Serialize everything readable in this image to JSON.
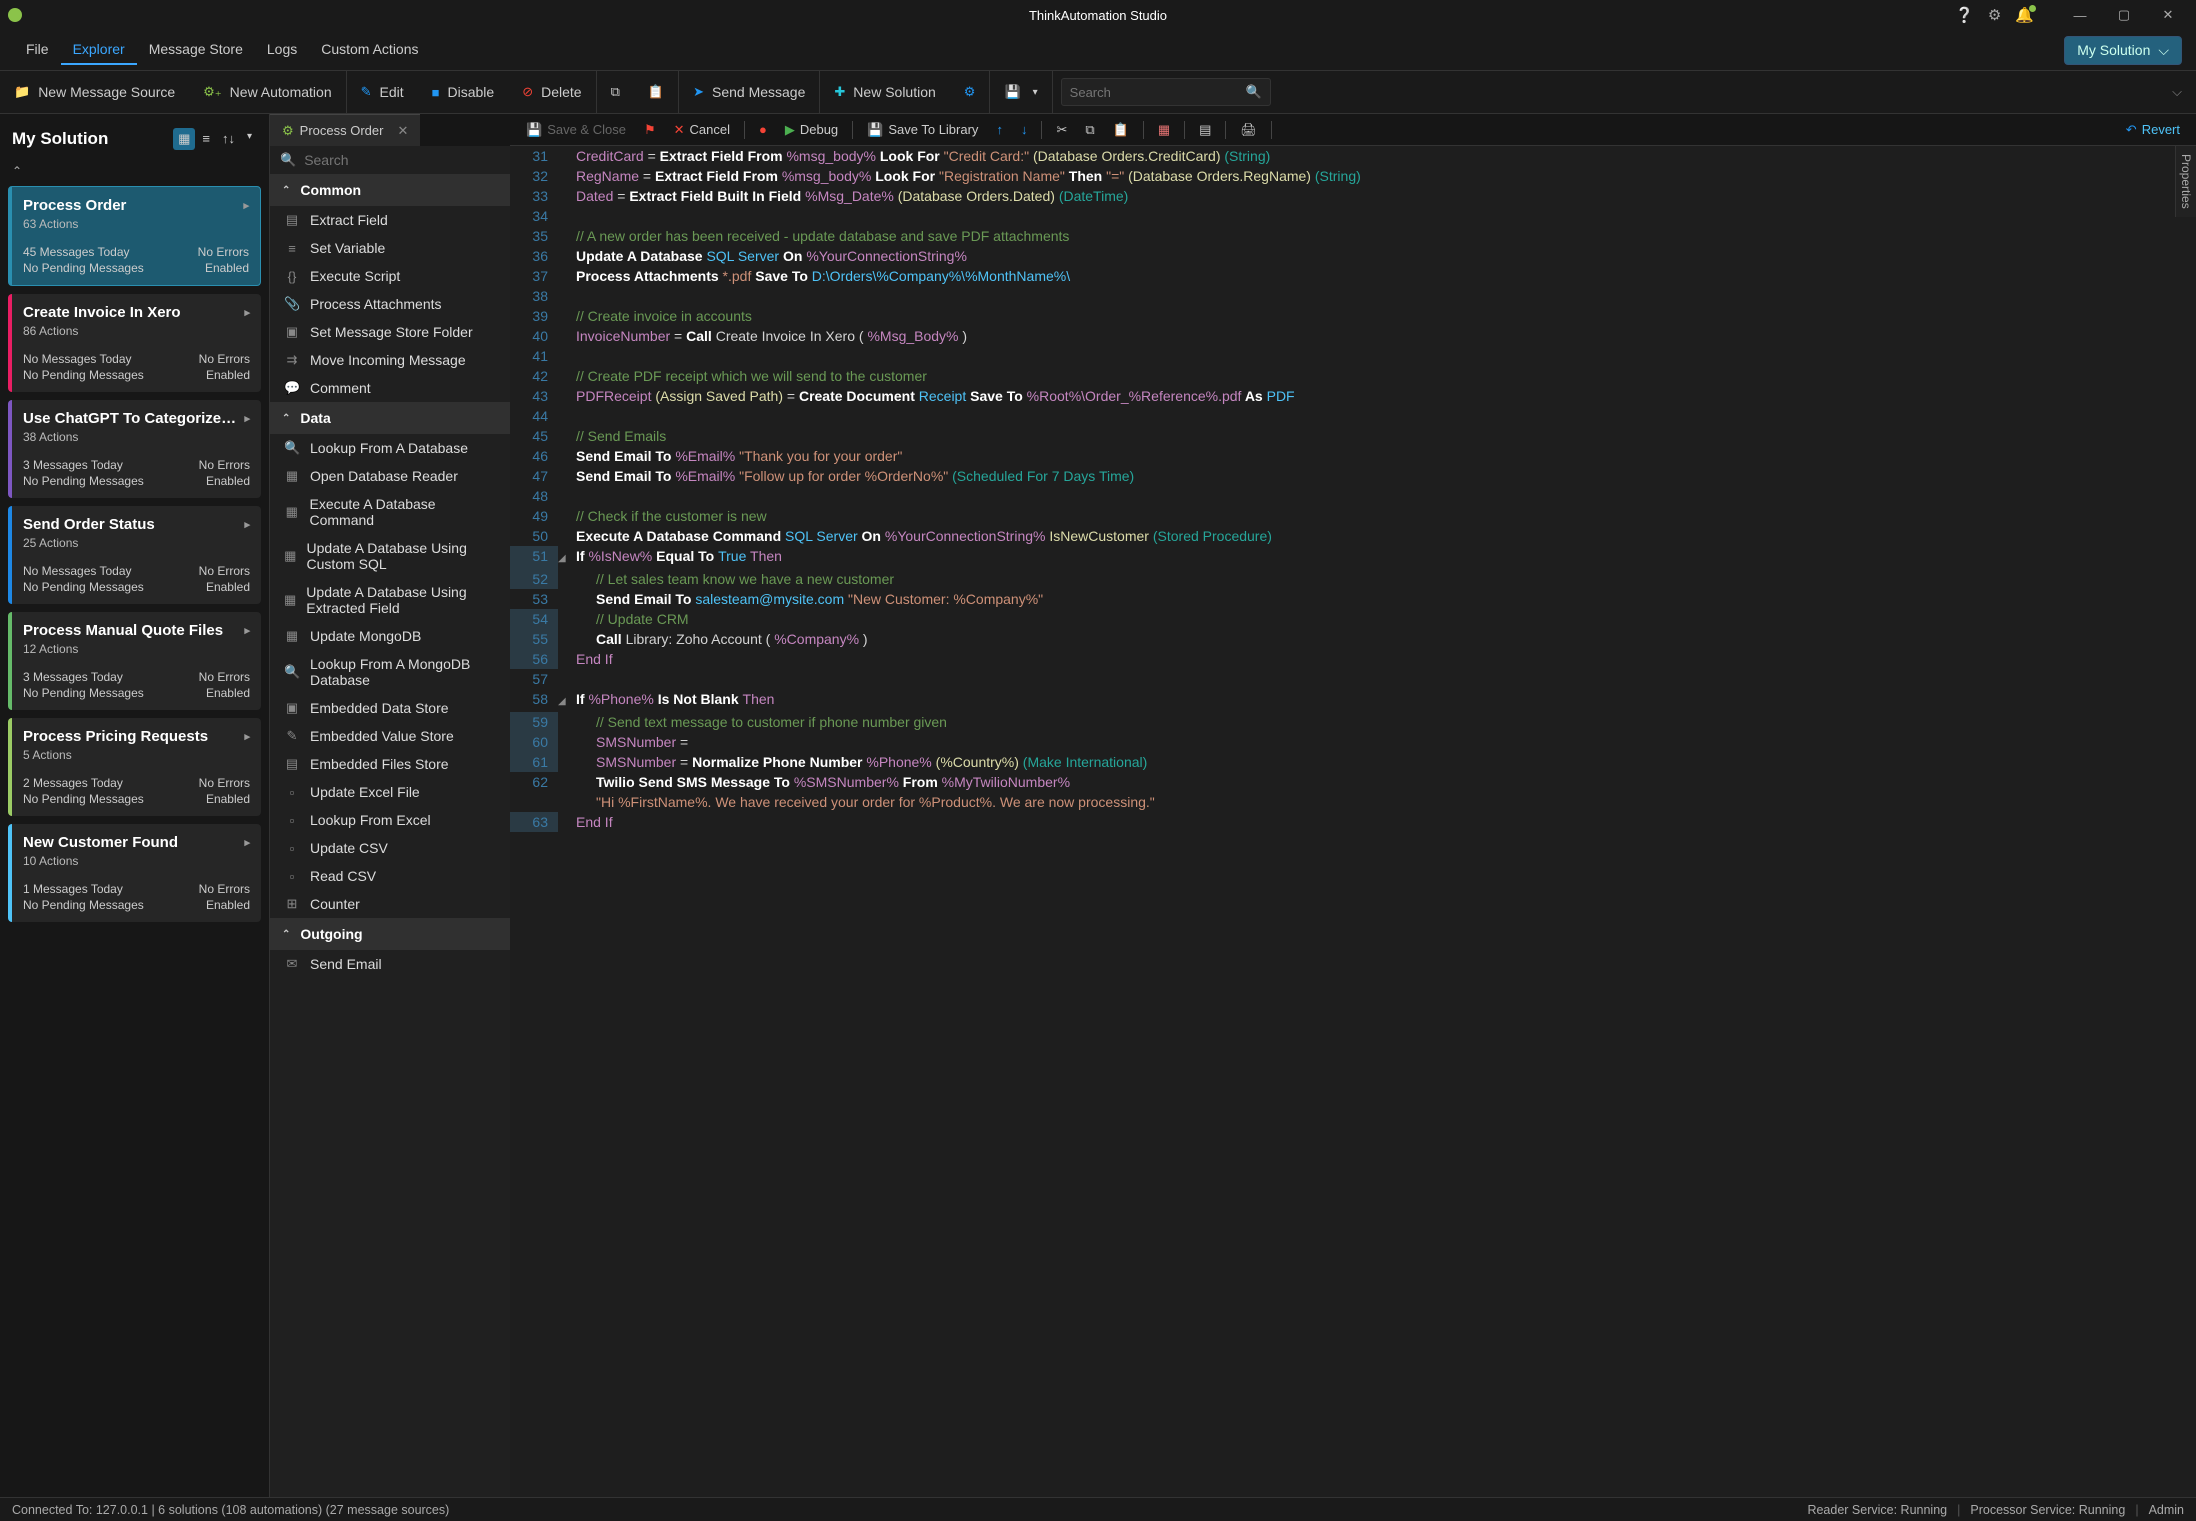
{
  "app_title": "ThinkAutomation Studio",
  "menubar": {
    "items": [
      "File",
      "Explorer",
      "Message Store",
      "Logs",
      "Custom Actions"
    ],
    "active": 1,
    "right_pill": "My Solution"
  },
  "toolbar": {
    "new_msg_src": "New Message Source",
    "new_automation": "New Automation",
    "edit": "Edit",
    "disable": "Disable",
    "delete": "Delete",
    "send_msg": "Send Message",
    "new_solution": "New Solution",
    "search_placeholder": "Search"
  },
  "sidebar": {
    "title": "My Solution",
    "cards": [
      {
        "title": "Process Order",
        "actions": "63 Actions",
        "m": "45 Messages Today",
        "e": "No Errors",
        "p": "No Pending Messages",
        "s": "Enabled",
        "color": "b-teal",
        "sel": true
      },
      {
        "title": "Create Invoice In Xero",
        "actions": "86 Actions",
        "m": "No Messages Today",
        "e": "No Errors",
        "p": "No Pending Messages",
        "s": "Enabled",
        "color": "b-pink"
      },
      {
        "title": "Use ChatGPT To Categorize…",
        "actions": "38 Actions",
        "m": "3 Messages Today",
        "e": "No Errors",
        "p": "No Pending Messages",
        "s": "Enabled",
        "color": "b-purple"
      },
      {
        "title": "Send Order Status",
        "actions": "25 Actions",
        "m": "No Messages Today",
        "e": "No Errors",
        "p": "No Pending Messages",
        "s": "Enabled",
        "color": "b-blue"
      },
      {
        "title": "Process Manual Quote Files",
        "actions": "12 Actions",
        "m": "3 Messages Today",
        "e": "No Errors",
        "p": "No Pending Messages",
        "s": "Enabled",
        "color": "b-green"
      },
      {
        "title": "Process Pricing Requests",
        "actions": "5 Actions",
        "m": "2 Messages Today",
        "e": "No Errors",
        "p": "No Pending Messages",
        "s": "Enabled",
        "color": "b-lime"
      },
      {
        "title": "New Customer Found",
        "actions": "10 Actions",
        "m": "1 Messages Today",
        "e": "No Errors",
        "p": "No Pending Messages",
        "s": "Enabled",
        "color": "b-sky"
      }
    ]
  },
  "center": {
    "tab": "Process Order",
    "search_placeholder": "Search",
    "groups": [
      {
        "name": "Common",
        "items": [
          {
            "i": "▤",
            "l": "Extract Field"
          },
          {
            "i": "≡",
            "l": "Set Variable"
          },
          {
            "i": "{}",
            "l": "Execute Script"
          },
          {
            "i": "📎",
            "l": "Process Attachments"
          },
          {
            "i": "▣",
            "l": "Set Message Store Folder"
          },
          {
            "i": "⇉",
            "l": "Move Incoming Message"
          },
          {
            "i": "💬",
            "l": "Comment"
          }
        ]
      },
      {
        "name": "Data",
        "items": [
          {
            "i": "🔍",
            "l": "Lookup From A Database"
          },
          {
            "i": "▦",
            "l": "Open Database Reader"
          },
          {
            "i": "▦",
            "l": "Execute A Database Command"
          },
          {
            "i": "▦",
            "l": "Update A Database Using Custom SQL"
          },
          {
            "i": "▦",
            "l": "Update A Database Using Extracted Field"
          },
          {
            "i": "▦",
            "l": "Update MongoDB"
          },
          {
            "i": "🔍",
            "l": "Lookup From A MongoDB Database"
          },
          {
            "i": "▣",
            "l": "Embedded Data Store"
          },
          {
            "i": "✎",
            "l": "Embedded Value Store"
          },
          {
            "i": "▤",
            "l": "Embedded Files Store"
          },
          {
            "i": "▫",
            "l": "Update Excel File"
          },
          {
            "i": "▫",
            "l": "Lookup From Excel"
          },
          {
            "i": "▫",
            "l": "Update CSV"
          },
          {
            "i": "▫",
            "l": "Read CSV"
          },
          {
            "i": "⊞",
            "l": "Counter"
          }
        ]
      },
      {
        "name": "Outgoing",
        "items": [
          {
            "i": "✉",
            "l": "Send Email"
          }
        ]
      }
    ]
  },
  "editor_toolbar": {
    "save_close": "Save & Close",
    "cancel": "Cancel",
    "debug": "Debug",
    "save_lib": "Save To Library",
    "revert": "Revert"
  },
  "code": [
    {
      "n": 31,
      "t": [
        [
          "c-var",
          "CreditCard"
        ],
        [
          "c-w",
          " = "
        ],
        [
          "c-key",
          "Extract Field From "
        ],
        [
          "c-pur",
          "%msg_body%"
        ],
        [
          "c-key",
          " Look For "
        ],
        [
          "c-orange",
          "\"Credit Card:\""
        ],
        [
          "c-w",
          " "
        ],
        [
          "c-ylw",
          "(Database Orders.CreditCard)"
        ],
        [
          "c-w",
          " "
        ],
        [
          "c-teal",
          "(String)"
        ]
      ]
    },
    {
      "n": 32,
      "t": [
        [
          "c-var",
          "RegName"
        ],
        [
          "c-w",
          " = "
        ],
        [
          "c-key",
          "Extract Field From "
        ],
        [
          "c-pur",
          "%msg_body%"
        ],
        [
          "c-key",
          " Look For "
        ],
        [
          "c-orange",
          "\"Registration Name\""
        ],
        [
          "c-key",
          " Then "
        ],
        [
          "c-orange",
          "\"=\""
        ],
        [
          "c-w",
          " "
        ],
        [
          "c-ylw",
          "(Database Orders.RegName)"
        ],
        [
          "c-w",
          " "
        ],
        [
          "c-teal",
          "(String)"
        ]
      ]
    },
    {
      "n": 33,
      "t": [
        [
          "c-var",
          "Dated"
        ],
        [
          "c-w",
          " = "
        ],
        [
          "c-key",
          "Extract Field Built In Field "
        ],
        [
          "c-pur",
          "%Msg_Date%"
        ],
        [
          "c-w",
          " "
        ],
        [
          "c-ylw",
          "(Database Orders.Dated)"
        ],
        [
          "c-w",
          " "
        ],
        [
          "c-teal",
          "(DateTime)"
        ]
      ]
    },
    {
      "n": 34,
      "t": []
    },
    {
      "n": 35,
      "t": [
        [
          "c-green",
          "// A new order has been received - update database and save PDF attachments"
        ]
      ]
    },
    {
      "n": 36,
      "t": [
        [
          "c-key",
          "Update A Database "
        ],
        [
          "c-blue",
          "SQL Server"
        ],
        [
          "c-key",
          " On "
        ],
        [
          "c-pur",
          "%YourConnectionString%"
        ]
      ]
    },
    {
      "n": 37,
      "t": [
        [
          "c-key",
          "Process Attachments "
        ],
        [
          "c-orange",
          "*.pdf"
        ],
        [
          "c-key",
          " Save To "
        ],
        [
          "c-blue",
          "D:\\Orders\\%Company%\\%MonthName%\\"
        ]
      ]
    },
    {
      "n": 38,
      "t": []
    },
    {
      "n": 39,
      "t": [
        [
          "c-green",
          "// Create invoice in accounts"
        ]
      ]
    },
    {
      "n": 40,
      "t": [
        [
          "c-var",
          "InvoiceNumber"
        ],
        [
          "c-w",
          " = "
        ],
        [
          "c-key",
          "Call "
        ],
        [
          "c-w",
          "Create Invoice In Xero ( "
        ],
        [
          "c-pur",
          "%Msg_Body%"
        ],
        [
          "c-w",
          " )"
        ]
      ]
    },
    {
      "n": 41,
      "t": []
    },
    {
      "n": 42,
      "t": [
        [
          "c-green",
          "// Create PDF receipt which we will send to the customer"
        ]
      ]
    },
    {
      "n": 43,
      "t": [
        [
          "c-var",
          "PDFReceipt"
        ],
        [
          "c-w",
          " "
        ],
        [
          "c-ylw",
          "(Assign Saved Path)"
        ],
        [
          "c-w",
          " = "
        ],
        [
          "c-key",
          "Create Document "
        ],
        [
          "c-blue",
          "Receipt"
        ],
        [
          "c-key",
          " Save To "
        ],
        [
          "c-pur",
          "%Root%\\Order_%Reference%.pdf"
        ],
        [
          "c-key",
          " As "
        ],
        [
          "c-blue",
          "PDF"
        ]
      ]
    },
    {
      "n": 44,
      "t": []
    },
    {
      "n": 45,
      "t": [
        [
          "c-green",
          "// Send Emails"
        ]
      ]
    },
    {
      "n": 46,
      "t": [
        [
          "c-key",
          "Send Email To "
        ],
        [
          "c-pur",
          "%Email%"
        ],
        [
          "c-w",
          " "
        ],
        [
          "c-orange",
          "\"Thank you for your order\""
        ]
      ]
    },
    {
      "n": 47,
      "t": [
        [
          "c-key",
          "Send Email To "
        ],
        [
          "c-pur",
          "%Email%"
        ],
        [
          "c-w",
          " "
        ],
        [
          "c-orange",
          "\"Follow up for order %OrderNo%\""
        ],
        [
          "c-w",
          " "
        ],
        [
          "c-teal",
          "(Scheduled For 7 Days Time)"
        ]
      ]
    },
    {
      "n": 48,
      "t": []
    },
    {
      "n": 49,
      "t": [
        [
          "c-green",
          "// Check if the customer is new"
        ]
      ]
    },
    {
      "n": 50,
      "t": [
        [
          "c-key",
          "Execute A Database Command "
        ],
        [
          "c-blue",
          "SQL Server"
        ],
        [
          "c-key",
          " On "
        ],
        [
          "c-pur",
          "%YourConnectionString%"
        ],
        [
          "c-w",
          " "
        ],
        [
          "c-ylw",
          "IsNewCustomer"
        ],
        [
          "c-w",
          " "
        ],
        [
          "c-teal",
          "(Stored Procedure)"
        ]
      ]
    },
    {
      "n": 51,
      "fold": true,
      "hi": true,
      "t": [
        [
          "c-key",
          "If "
        ],
        [
          "c-pur",
          "%IsNew%"
        ],
        [
          "c-key",
          " Equal To "
        ],
        [
          "c-blue",
          "True"
        ],
        [
          "c-w",
          " "
        ],
        [
          "c-pur",
          "Then"
        ]
      ]
    },
    {
      "n": 52,
      "ind": 1,
      "hi": true,
      "t": [
        [
          "c-green",
          "// Let sales team know we have a new customer"
        ]
      ]
    },
    {
      "n": 53,
      "ind": 1,
      "t": [
        [
          "c-key",
          "Send Email To "
        ],
        [
          "c-blue",
          "salesteam@mysite.com"
        ],
        [
          "c-w",
          " "
        ],
        [
          "c-orange",
          "\"New Customer: %Company%\""
        ]
      ]
    },
    {
      "n": 54,
      "ind": 1,
      "hi": true,
      "t": [
        [
          "c-green",
          "// Update CRM"
        ]
      ]
    },
    {
      "n": 55,
      "ind": 1,
      "hi": true,
      "t": [
        [
          "c-key",
          "Call "
        ],
        [
          "c-w",
          "Library: Zoho Account ( "
        ],
        [
          "c-pur",
          "%Company%"
        ],
        [
          "c-w",
          " )"
        ]
      ]
    },
    {
      "n": 56,
      "hi": true,
      "t": [
        [
          "c-pur",
          "End If"
        ]
      ]
    },
    {
      "n": 57,
      "t": []
    },
    {
      "n": 58,
      "fold": true,
      "t": [
        [
          "c-key",
          "If "
        ],
        [
          "c-pur",
          "%Phone%"
        ],
        [
          "c-key",
          " Is Not Blank "
        ],
        [
          "c-pur",
          "Then"
        ]
      ]
    },
    {
      "n": 59,
      "ind": 1,
      "hi": true,
      "t": [
        [
          "c-green",
          "// Send text message to customer if phone number given"
        ]
      ]
    },
    {
      "n": 60,
      "ind": 1,
      "hi": true,
      "t": [
        [
          "c-var",
          "SMSNumber"
        ],
        [
          "c-w",
          " ="
        ]
      ]
    },
    {
      "n": 61,
      "ind": 1,
      "hi": true,
      "t": [
        [
          "c-var",
          "SMSNumber"
        ],
        [
          "c-w",
          " = "
        ],
        [
          "c-key",
          "Normalize Phone Number "
        ],
        [
          "c-pur",
          "%Phone%"
        ],
        [
          "c-w",
          " "
        ],
        [
          "c-ylw",
          "(%Country%)"
        ],
        [
          "c-w",
          " "
        ],
        [
          "c-teal",
          "(Make International)"
        ]
      ]
    },
    {
      "n": 62,
      "ind": 1,
      "t": [
        [
          "c-key",
          "Twilio Send SMS Message To "
        ],
        [
          "c-pur",
          "%SMSNumber%"
        ],
        [
          "c-key",
          " From "
        ],
        [
          "c-pur",
          "%MyTwilioNumber%"
        ]
      ],
      "t2": [
        [
          "c-orange",
          "\"Hi %FirstName%. We have received your order for %Product%. We are now processing.\""
        ]
      ]
    },
    {
      "n": 63,
      "hi": true,
      "t": [
        [
          "c-pur",
          "End If"
        ]
      ]
    }
  ],
  "statusbar": {
    "left": "Connected To: 127.0.0.1 | 6 solutions (108 automations) (27 message sources)",
    "reader": "Reader Service: Running",
    "processor": "Processor Service: Running",
    "user": "Admin"
  },
  "properties_tab": "Properties"
}
